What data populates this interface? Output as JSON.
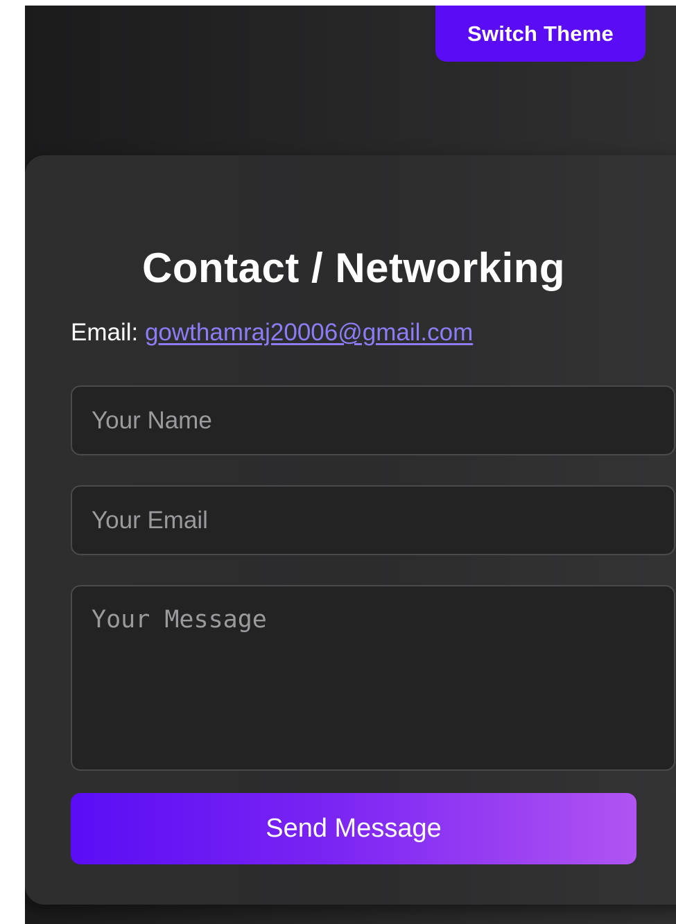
{
  "header": {
    "theme_button_label": "Switch Theme"
  },
  "contact": {
    "title": "Contact / Networking",
    "email_label": "Email: ",
    "email_address": "gowthamraj20006@gmail.com"
  },
  "form": {
    "name_placeholder": "Your Name",
    "email_placeholder": "Your Email",
    "message_placeholder": "Your Message",
    "submit_label": "Send Message"
  },
  "colors": {
    "accent": "#5a0df5",
    "accent_gradient_end": "#b054f2",
    "link": "#8c7cf6",
    "background": "#242425"
  }
}
